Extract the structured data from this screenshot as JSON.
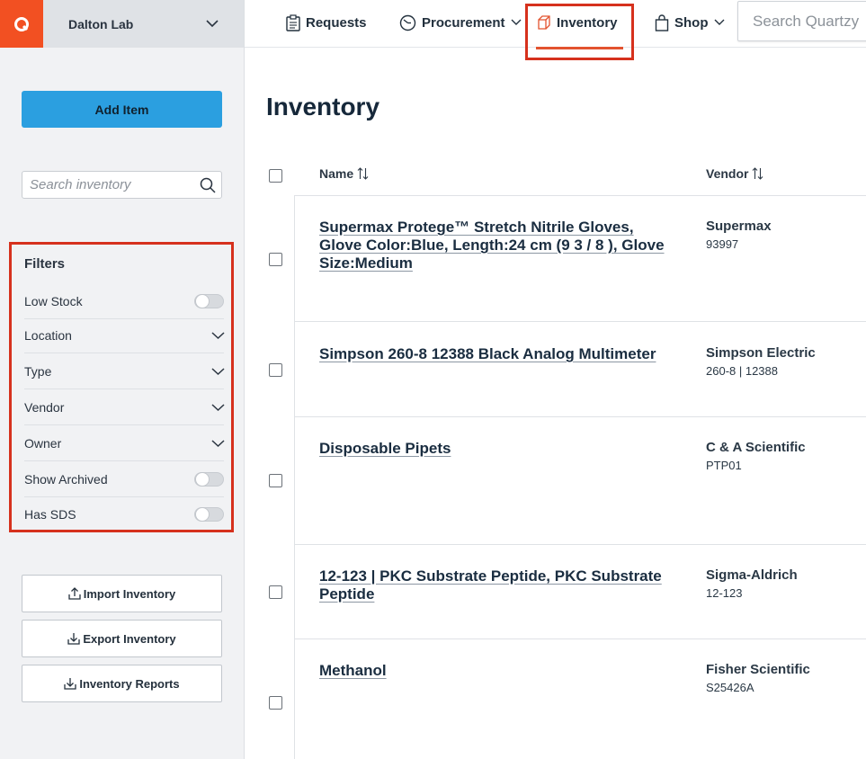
{
  "org": {
    "name": "Dalton Lab"
  },
  "nav": {
    "requests": "Requests",
    "procurement": "Procurement",
    "inventory": "Inventory",
    "shop": "Shop",
    "search_placeholder": "Search Quartzy"
  },
  "sidebar": {
    "add_item": "Add Item",
    "search_placeholder": "Search inventory",
    "filters_title": "Filters",
    "filters": [
      {
        "label": "Low Stock",
        "control": "toggle",
        "on": false
      },
      {
        "label": "Location",
        "control": "dropdown"
      },
      {
        "label": "Type",
        "control": "dropdown"
      },
      {
        "label": "Vendor",
        "control": "dropdown"
      },
      {
        "label": "Owner",
        "control": "dropdown"
      },
      {
        "label": "Show Archived",
        "control": "toggle",
        "on": false
      },
      {
        "label": "Has SDS",
        "control": "toggle",
        "on": false
      }
    ],
    "buttons": {
      "import": "Import Inventory",
      "export": "Export Inventory",
      "reports": "Inventory Reports"
    }
  },
  "main": {
    "title": "Inventory",
    "columns": {
      "name": "Name",
      "vendor": "Vendor"
    },
    "rows": [
      {
        "name": "Supermax Protege™ Stretch Nitrile Gloves, Glove Color:Blue, Length:24 cm (9 3 / 8 ), Glove Size:Medium",
        "vendor": "Supermax",
        "catalog": "93997"
      },
      {
        "name": "Simpson 260-8 12388 Black Analog Multimeter",
        "vendor": "Simpson Electric",
        "catalog": "260-8 | 12388"
      },
      {
        "name": "Disposable Pipets",
        "vendor": "C & A Scientific",
        "catalog": "PTP01"
      },
      {
        "name": "12-123 | PKC Substrate Peptide, PKC Substrate Peptide",
        "vendor": "Sigma-Aldrich",
        "catalog": "12-123"
      },
      {
        "name": "Methanol",
        "vendor": "Fisher Scientific",
        "catalog": "S25426A"
      }
    ]
  },
  "colors": {
    "brand": "#f25022",
    "primary": "#2b9fe0",
    "highlight": "#d6311d"
  }
}
